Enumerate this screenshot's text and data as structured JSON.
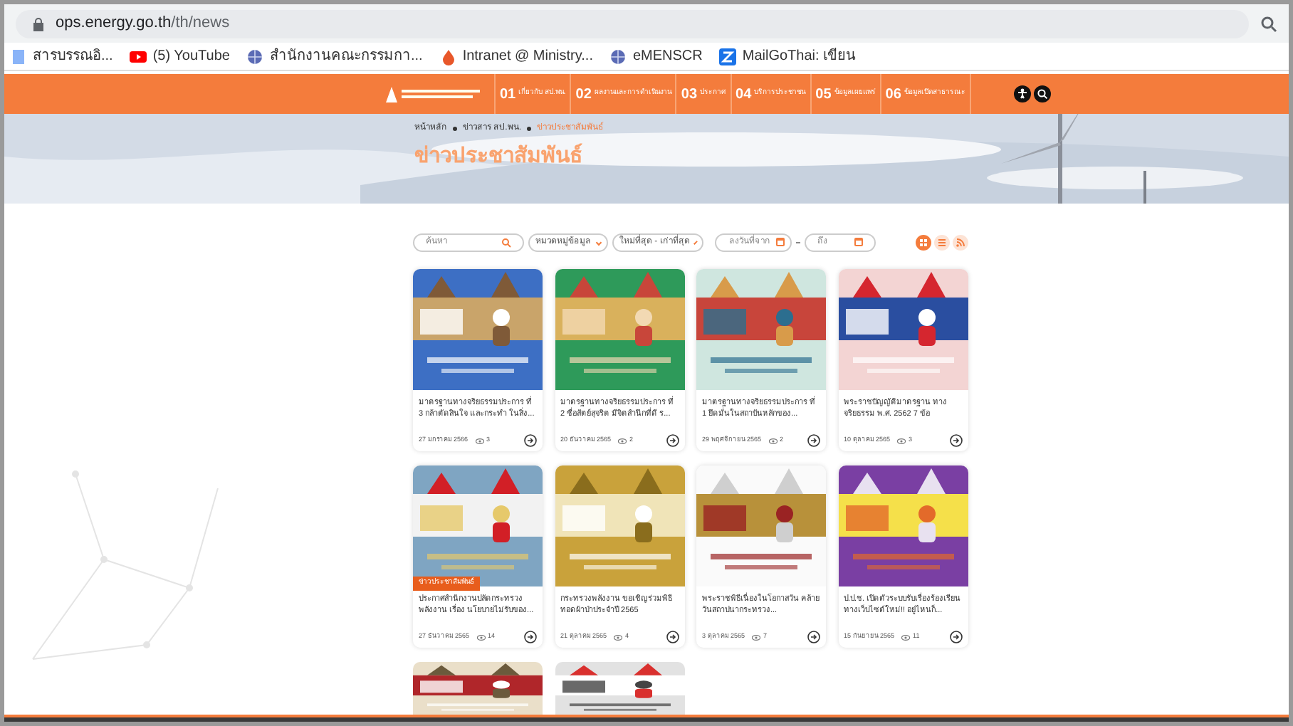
{
  "browser": {
    "url_domain": "ops.energy.go.th",
    "url_path": "/th/news",
    "bookmarks": [
      {
        "kind": "doc",
        "label": "สารบรรณอิ..."
      },
      {
        "kind": "youtube",
        "label": "(5) YouTube"
      },
      {
        "kind": "globe",
        "label": "สำนักงานคณะกรรมกา..."
      },
      {
        "kind": "flame",
        "label": "Intranet @ Ministry..."
      },
      {
        "kind": "globe",
        "label": "eMENSCR"
      },
      {
        "kind": "mail",
        "label": "MailGoThai: เขียน"
      }
    ]
  },
  "nav": {
    "items": [
      {
        "number": "01",
        "label": "เกี่ยวกับ สป.พน."
      },
      {
        "number": "02",
        "label": "ผลงานและการดำเนินงาน"
      },
      {
        "number": "03",
        "label": "ประกาศ"
      },
      {
        "number": "04",
        "label": "บริการประชาชน"
      },
      {
        "number": "05",
        "label": "ข้อมูลเผยแพร่"
      },
      {
        "number": "06",
        "label": "ข้อมูลเปิดสาธารณะ"
      }
    ]
  },
  "banner": {
    "breadcrumb": [
      "หน้าหลัก",
      "ข่าวสาร สป.พน.",
      "ข่าวประชาสัมพันธ์"
    ],
    "title": "ข่าวประชาสัมพันธ์"
  },
  "filters": {
    "search_placeholder": "ค้นหา",
    "category": "หมวดหมู่ข้อมูล",
    "sort": "ใหม่ที่สุด - เก่าที่สุด",
    "date_from_placeholder": "ลงวันที่จาก",
    "date_to_placeholder": "ถึง",
    "views": [
      {
        "kind": "grid",
        "selected": true
      },
      {
        "kind": "list",
        "selected": false
      },
      {
        "kind": "rss",
        "selected": false
      }
    ]
  },
  "cards": [
    {
      "title": "มาตรฐานทางจริยธรรมประการ ที่ 3 กล้าตัดสินใจ และกระทำ ในสิ่ง...",
      "date": "27 มกราคม 2566",
      "views": "3"
    },
    {
      "title": "มาตรฐานทางจริยธรรมประการ ที่ 2 ซื่อสัตย์สุจริต มีจิตสำนึกที่ดี ร...",
      "date": "20 ธันวาคม 2565",
      "views": "2"
    },
    {
      "title": "มาตรฐานทางจริยธรรมประการ ที่ 1 ยึดมั่นในสถาบันหลักของ...",
      "date": "29 พฤศจิกายน 2565",
      "views": "2"
    },
    {
      "title": "พระราชบัญญัติมาตรฐาน ทางจริยธรรม พ.ศ. 2562 7 ข้อ",
      "date": "10 ตุลาคม 2565",
      "views": "3"
    },
    {
      "badge": "ข่าวประชาสัมพันธ์",
      "title": "ประกาศสำนักงานปลัดกระทรวงพลังงาน เรื่อง นโยบายไม่รับของ...",
      "date": "27 ธันวาคม 2565",
      "views": "14"
    },
    {
      "title": "กระทรวงพลังงาน ขอเชิญร่วมพิธีทอดผ้าป่าประจำปี 2565",
      "date": "21 ตุลาคม 2565",
      "views": "4"
    },
    {
      "title": "พระราชพิธีเนื่องในโอกาสวัน คล้ายวันสถาปนากระทรวง...",
      "date": "3 ตุลาคม 2565",
      "views": "7"
    },
    {
      "title": "ป.ป.ช. เปิดตัวระบบรับเรื่องร้องเรียน ทางเว็บไซต์ใหม่!! อยู่ไหนก็...",
      "date": "15 กันยายน 2565",
      "views": "11"
    },
    {
      "kind": "picture"
    },
    {
      "kind": "picture"
    }
  ]
}
